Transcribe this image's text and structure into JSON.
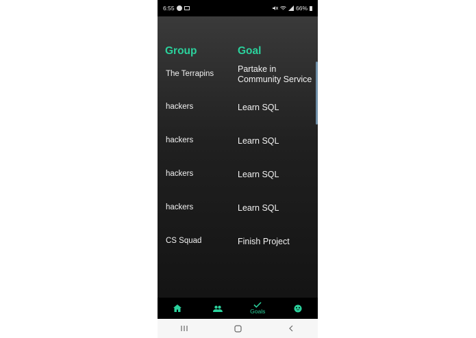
{
  "status_bar": {
    "time": "6:55",
    "battery_text": "66%",
    "icons": [
      "face-icon",
      "image-icon",
      "mute-icon",
      "wifi-icon",
      "signal-icon",
      "battery-icon"
    ]
  },
  "table": {
    "headers": {
      "group": "Group",
      "goal": "Goal"
    },
    "rows": [
      {
        "group": "The Terrapins",
        "goal": "Partake in Community Service"
      },
      {
        "group": "hackers",
        "goal": "Learn SQL"
      },
      {
        "group": "hackers",
        "goal": "Learn SQL"
      },
      {
        "group": "hackers",
        "goal": "Learn SQL"
      },
      {
        "group": "hackers",
        "goal": "Learn SQL"
      },
      {
        "group": "CS Squad",
        "goal": "Finish Project"
      }
    ]
  },
  "bottom_nav": {
    "items": [
      {
        "icon": "home-icon",
        "label": ""
      },
      {
        "icon": "people-icon",
        "label": ""
      },
      {
        "icon": "check-icon",
        "label": "Goals",
        "active": true
      },
      {
        "icon": "smiley-icon",
        "label": ""
      }
    ]
  },
  "colors": {
    "accent": "#2bd19c",
    "text": "#f2f2f2",
    "background": "#1e1e1e"
  }
}
